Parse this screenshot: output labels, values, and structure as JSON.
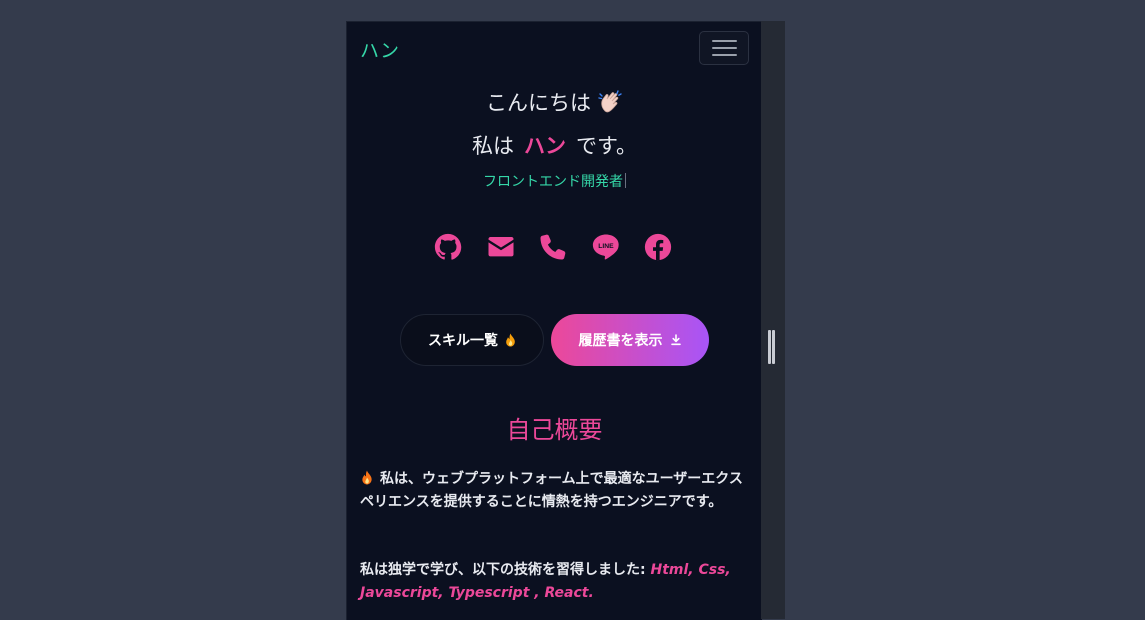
{
  "navbar": {
    "brand": "ハン",
    "menu_icon": "hamburger-icon"
  },
  "hero": {
    "greeting": "こんにちは",
    "greeting_icon": "waving-hand-icon",
    "intro_prefix": "私は",
    "name": "ハン",
    "intro_suffix": "です。",
    "role": "フロントエンド開発者"
  },
  "socials": [
    {
      "name": "github",
      "icon": "github-icon"
    },
    {
      "name": "email",
      "icon": "envelope-icon"
    },
    {
      "name": "phone",
      "icon": "phone-icon"
    },
    {
      "name": "line",
      "icon": "line-icon"
    },
    {
      "name": "facebook",
      "icon": "facebook-icon"
    }
  ],
  "buttons": {
    "skills_label": "スキル一覧",
    "skills_icon": "fire-icon",
    "resume_label": "履歴書を表示",
    "resume_icon": "download-icon"
  },
  "about": {
    "title": "自己概要",
    "paragraph1": "私は、ウェブプラットフォーム上で最適なユーザーエクスペリエンスを提供することに情熱を持つエンジニアです。",
    "paragraph2_prefix": "私は独学で学び、以下の技術を習得しました: ",
    "technologies": "Html, Css, Javascript, Typescript , React."
  },
  "colors": {
    "accent_pink": "#ec4899",
    "accent_green": "#35d7a8",
    "background": "#0b1020",
    "gradient_end": "#a855f7"
  }
}
